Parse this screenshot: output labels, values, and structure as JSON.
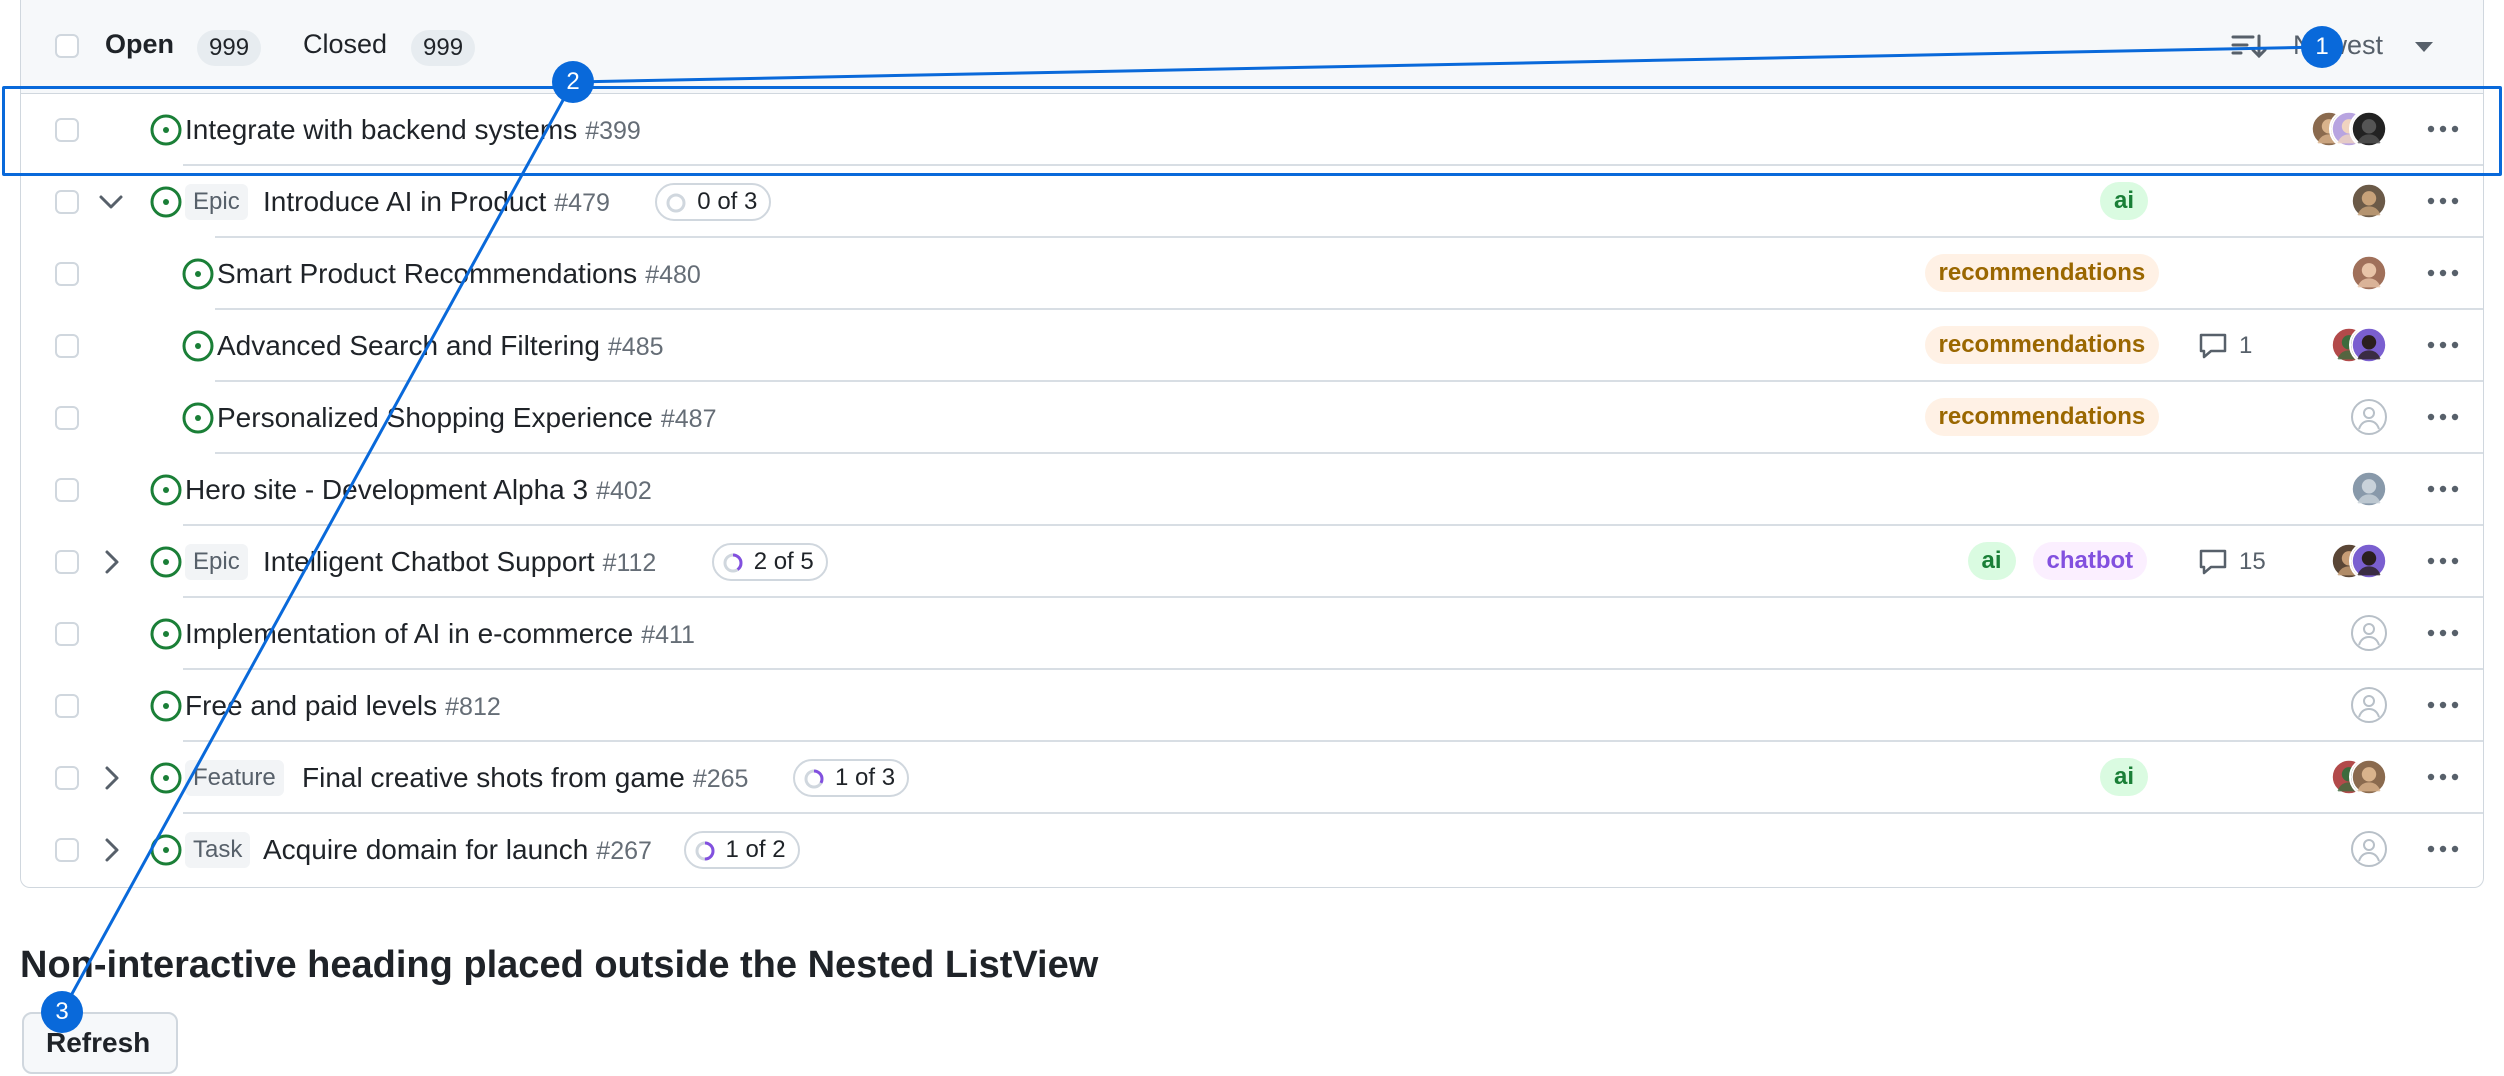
{
  "header": {
    "open_label": "Open",
    "open_count": "999",
    "closed_label": "Closed",
    "closed_count": "999",
    "sort_label": "Newest"
  },
  "rows": [
    {
      "title": "Integrate with backend systems",
      "number": "#399",
      "status": "open",
      "avatars": [
        "avatar-a",
        "avatar-b",
        "avatar-c"
      ]
    },
    {
      "type": "Epic",
      "title": "Introduce AI in Product",
      "number": "#479",
      "progress": "0 of 3",
      "progress_fraction": 0,
      "expanded": true,
      "labels": [
        "ai"
      ],
      "avatars": [
        "avatar-d"
      ]
    },
    {
      "title": "Smart Product Recommendations",
      "number": "#480",
      "labels": [
        "recommendations"
      ],
      "avatars": [
        "avatar-e"
      ],
      "child": true
    },
    {
      "title": "Advanced Search and Filtering",
      "number": "#485",
      "labels": [
        "recommendations"
      ],
      "comments": "1",
      "avatars": [
        "avatar-f",
        "avatar-g"
      ],
      "child": true
    },
    {
      "title": "Personalized Shopping Experience",
      "number": "#487",
      "labels": [
        "recommendations"
      ],
      "avatars": [],
      "child": true
    },
    {
      "title": "Hero site - Development Alpha 3",
      "number": "#402",
      "avatars": [
        "avatar-h"
      ]
    },
    {
      "type": "Epic",
      "title": "Intelligent Chatbot Support",
      "number": "#112",
      "progress": "2 of 5",
      "progress_fraction": 0.4,
      "collapsed": true,
      "labels": [
        "ai",
        "chatbot"
      ],
      "comments": "15",
      "avatars": [
        "avatar-i",
        "avatar-g"
      ]
    },
    {
      "title": "Implementation of AI in e-commerce",
      "number": "#411",
      "avatars": []
    },
    {
      "title": "Free and paid levels",
      "number": "#812",
      "avatars": []
    },
    {
      "type": "Feature",
      "title": "Final creative shots from game",
      "number": "#265",
      "progress": "1 of 3",
      "progress_fraction": 0.33,
      "collapsed": true,
      "labels": [
        "ai"
      ],
      "avatars": [
        "avatar-f",
        "avatar-a"
      ]
    },
    {
      "type": "Task",
      "title": "Acquire domain for launch",
      "number": "#267",
      "progress": "1 of 2",
      "progress_fraction": 0.5,
      "collapsed": true,
      "avatars": []
    }
  ],
  "labels_style": {
    "ai": {
      "bg": "#dafbe1",
      "fg": "#1a7f37"
    },
    "recommendations": {
      "bg": "#fff1e5",
      "fg": "#9a6700"
    },
    "chatbot": {
      "bg": "#fbefff",
      "fg": "#8250df"
    }
  },
  "heading": "Non-interactive heading placed outside the Nested ListView",
  "refresh_label": "Refresh",
  "markers": [
    "1",
    "2",
    "3"
  ],
  "colors": {
    "accent": "#0969da",
    "open_status": "#1a7f37",
    "border": "#d0d7de"
  }
}
